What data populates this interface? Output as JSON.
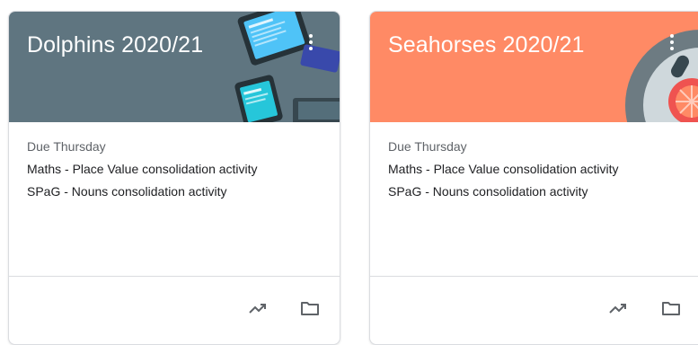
{
  "cards": [
    {
      "title": "Dolphins 2020/21",
      "due_label": "Due Thursday",
      "assignments": [
        "Maths - Place Value consolidation activity",
        "SPaG - Nouns consolidation activity"
      ],
      "banner_color": "#5f7580",
      "more_icon": "more-vert-icon",
      "actions": [
        "trending-up-icon",
        "folder-icon"
      ]
    },
    {
      "title": "Seahorses 2020/21",
      "due_label": "Due Thursday",
      "assignments": [
        "Maths - Place Value consolidation activity",
        "SPaG - Nouns consolidation activity"
      ],
      "banner_color": "#ff8a65",
      "more_icon": "more-vert-icon",
      "actions": [
        "trending-up-icon",
        "folder-icon"
      ]
    }
  ],
  "colors": {
    "title_text": "#ffffff",
    "due_text": "#5f6368",
    "body_text": "#202124",
    "divider": "#dadce0",
    "icon": "#5f6368"
  }
}
